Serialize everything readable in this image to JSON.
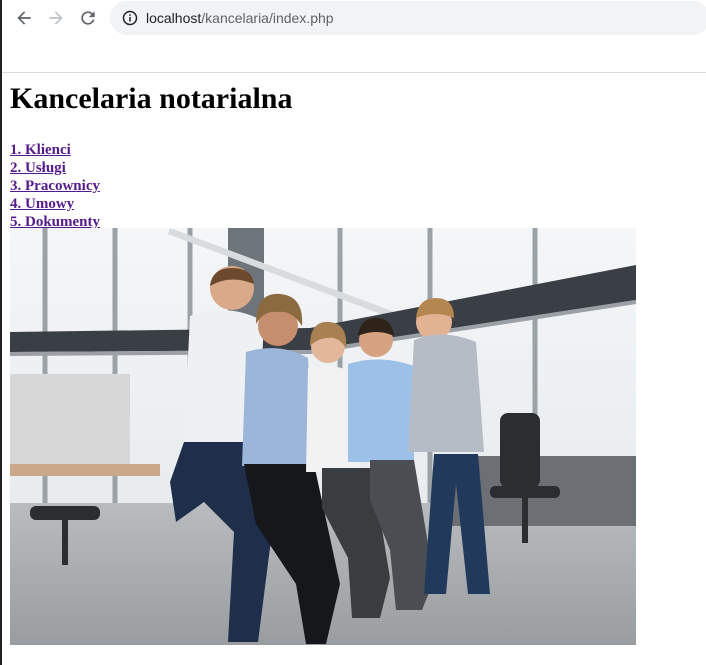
{
  "browser": {
    "url_host": "localhost",
    "url_path": "/kancelaria/index.php"
  },
  "page": {
    "title": "Kancelaria notarialna",
    "menu": [
      {
        "label": "1. Klienci"
      },
      {
        "label": "2. Usługi"
      },
      {
        "label": "3. Pracownicy"
      },
      {
        "label": "4. Umowy"
      },
      {
        "label": "5. Dokumenty"
      }
    ]
  },
  "icons": {
    "back": "back-arrow-icon",
    "forward": "forward-arrow-icon",
    "reload": "reload-icon",
    "info": "site-info-icon"
  },
  "colors": {
    "link_visited": "#551a8b",
    "omnibox_bg": "#f1f3f4"
  }
}
